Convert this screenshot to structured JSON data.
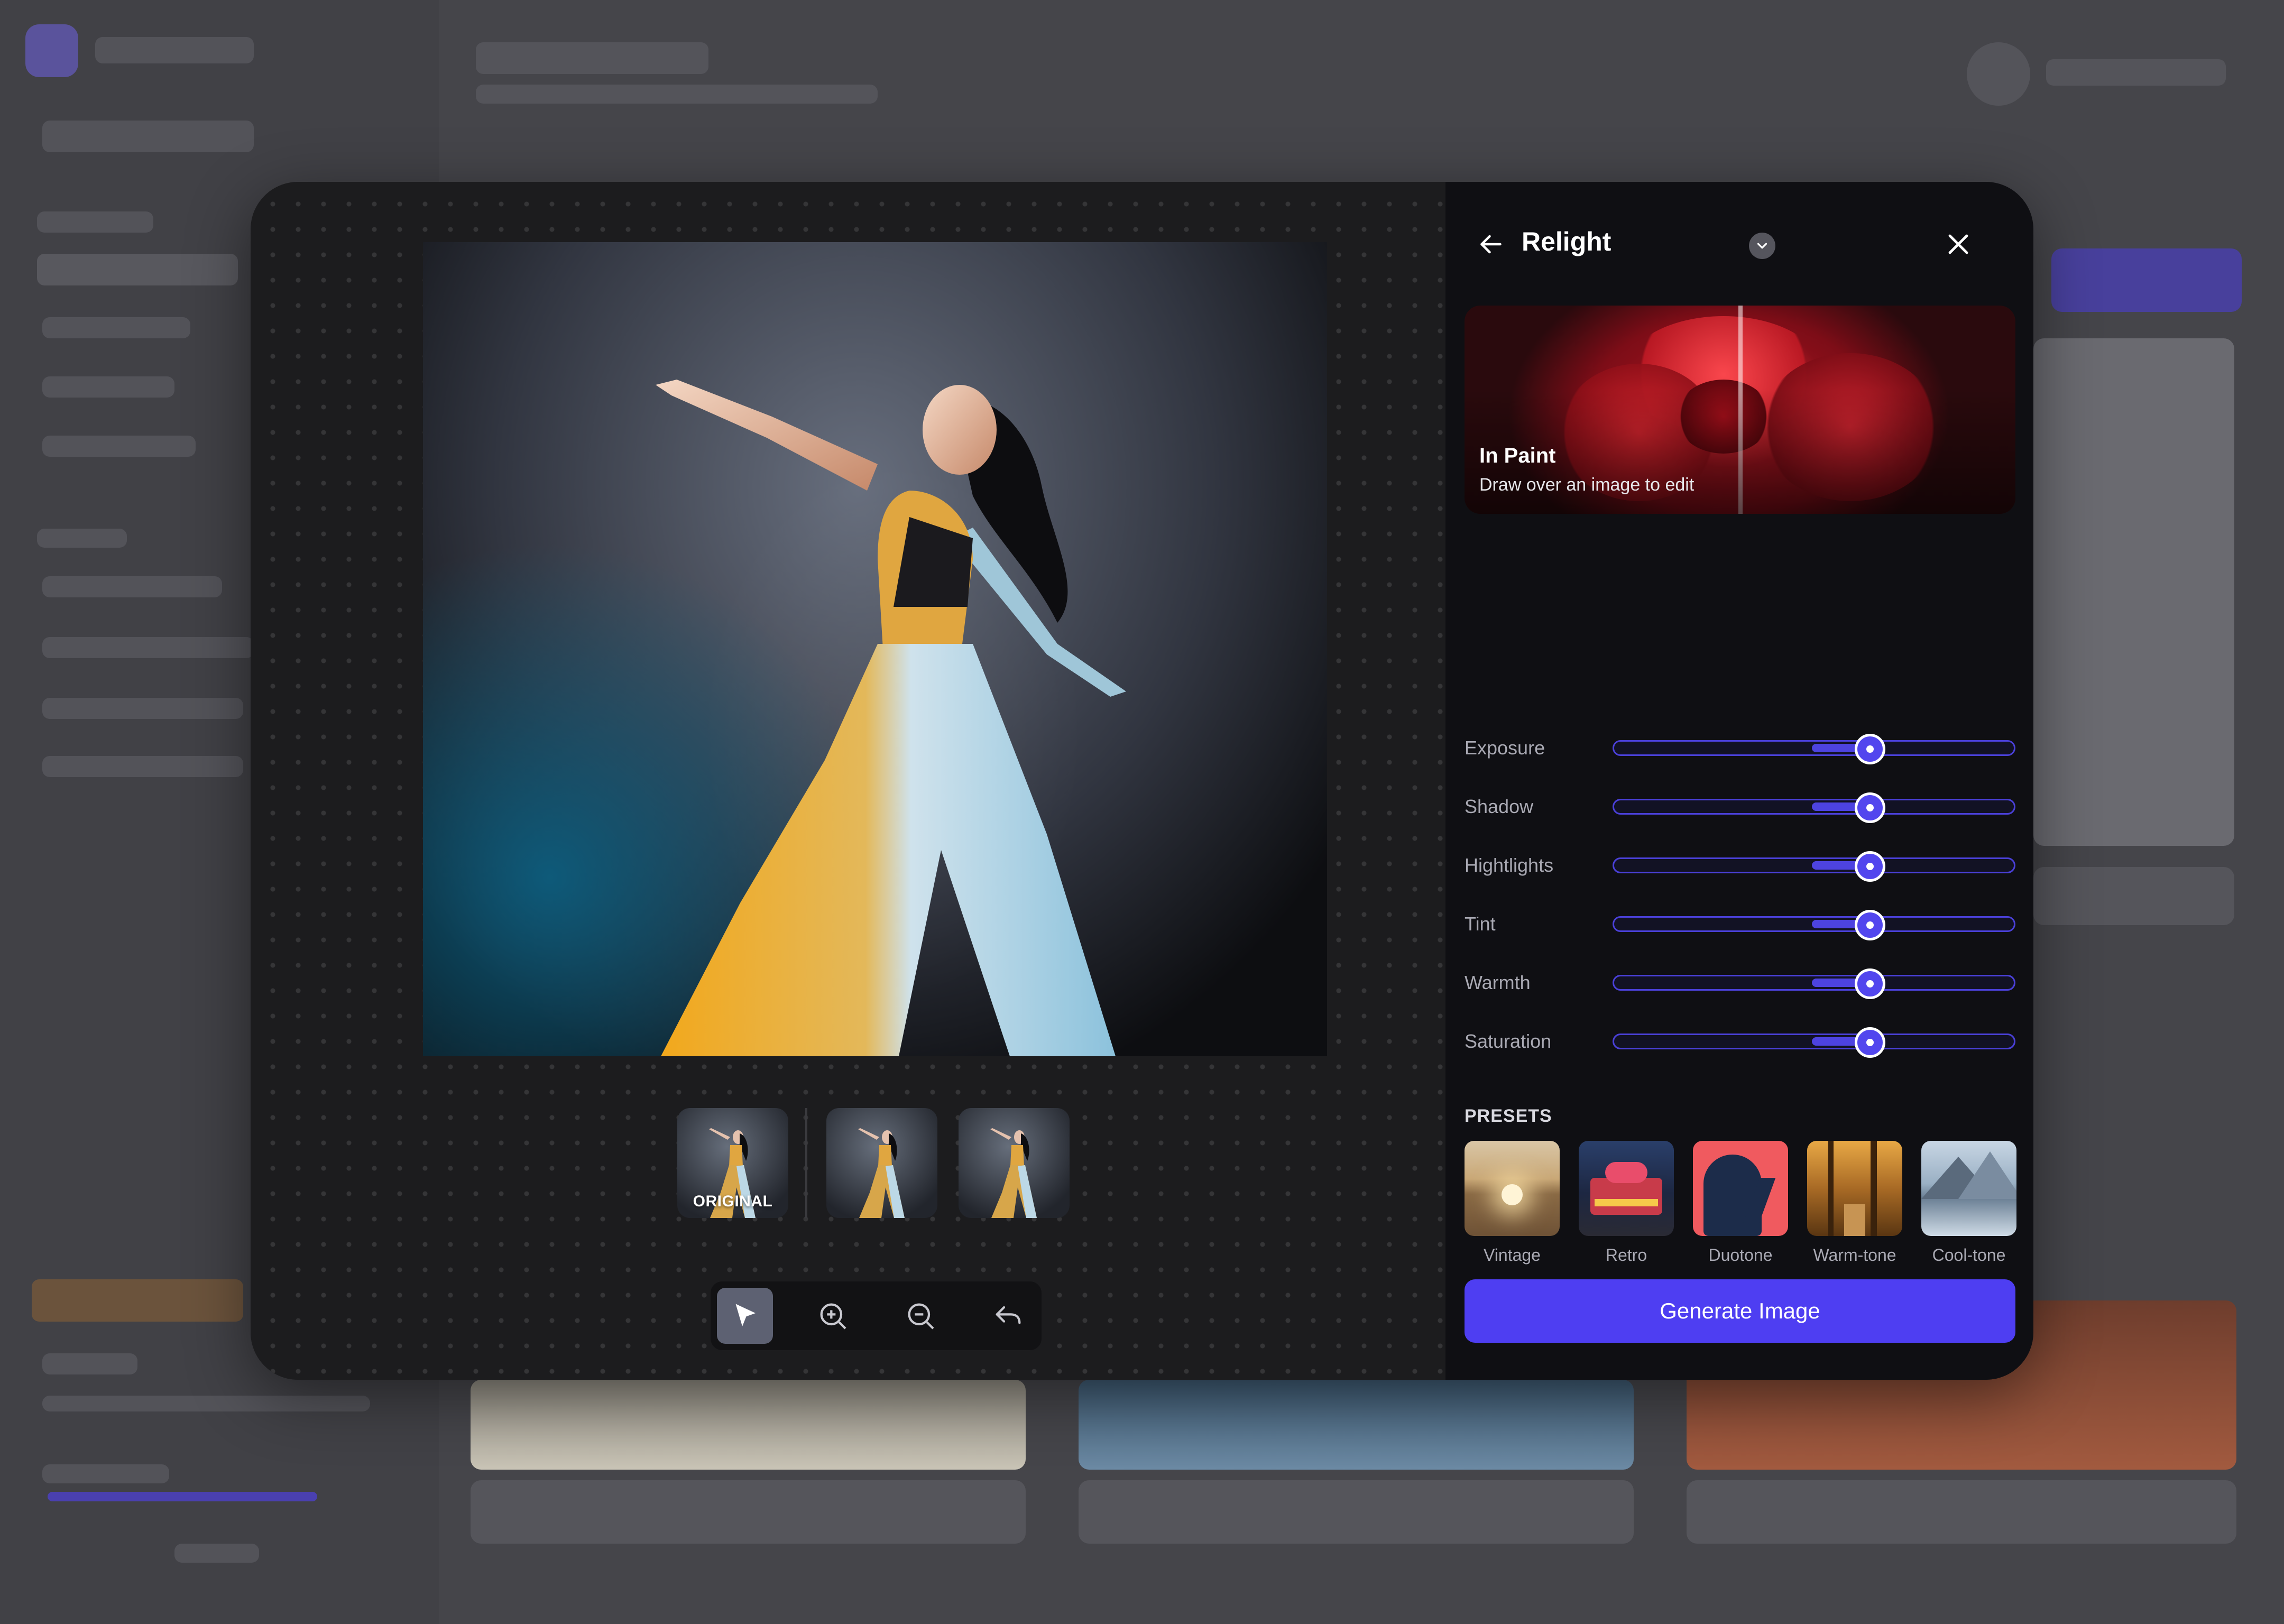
{
  "editor": {
    "thumbnails": [
      {
        "label": "ORIGINAL",
        "selected": true
      },
      {
        "label": ""
      },
      {
        "label": ""
      }
    ],
    "toolbar": {
      "tools": [
        {
          "icon": "cursor-icon",
          "active": true
        },
        {
          "icon": "zoom-in-icon",
          "active": false
        },
        {
          "icon": "zoom-out-icon",
          "active": false
        },
        {
          "icon": "undo-icon",
          "active": false
        }
      ]
    }
  },
  "panel": {
    "title": "Relight",
    "inpaint": {
      "title": "In Paint",
      "subtitle": "Draw over an image to edit"
    },
    "sliders": [
      {
        "label": "Exposure",
        "value": 0.64
      },
      {
        "label": "Shadow",
        "value": 0.64
      },
      {
        "label": "Hightlights",
        "value": 0.64
      },
      {
        "label": "Tint",
        "value": 0.64
      },
      {
        "label": "Warmth",
        "value": 0.64
      },
      {
        "label": "Saturation",
        "value": 0.64
      }
    ],
    "presets_title": "PRESETS",
    "presets": [
      {
        "label": "Vintage"
      },
      {
        "label": "Retro"
      },
      {
        "label": "Duotone"
      },
      {
        "label": "Warm-tone"
      },
      {
        "label": "Cool-tone"
      }
    ],
    "generate_label": "Generate Image"
  },
  "colors": {
    "accent": "#4e3ef2",
    "panel_bg": "#0f0f13",
    "canvas_bg": "#1c1c1e"
  }
}
